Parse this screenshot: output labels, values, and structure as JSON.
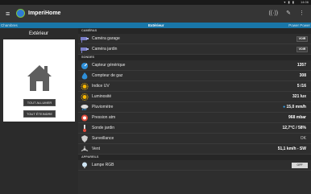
{
  "statusbar": {
    "icons": "▾ ▮ ▮",
    "clock": "14:06"
  },
  "appbar": {
    "title": "ImperiHome",
    "menu_icon": "menu-icon",
    "tools": [
      "((·))",
      "✎",
      "⋮"
    ]
  },
  "tabs": {
    "left": "Chambres",
    "center": "Extérieur",
    "right": "Power Power"
  },
  "room": {
    "title": "Extérieur",
    "button_all_on": "TOUT ALLUMER",
    "button_all_off": "TOUT ÉTEINDRE"
  },
  "sections": {
    "cameras": "CAMÉRAS",
    "sondes": "SONDES",
    "appareils": "APPAREILS"
  },
  "cameras": [
    {
      "label": "Caméra garage",
      "action": "VOIR"
    },
    {
      "label": "Caméra jardin",
      "action": "VOIR"
    }
  ],
  "sondes": [
    {
      "label": "Capteur générique",
      "value": "1357",
      "icon": "gauge-icon"
    },
    {
      "label": "Compteur de gaz",
      "value": "308",
      "icon": "flame-icon"
    },
    {
      "label": "Indice UV",
      "value": "5 /16",
      "icon": "sun-icon"
    },
    {
      "label": "Luminosité",
      "value": "321 lux",
      "icon": "sun-icon"
    },
    {
      "label": "Pluviomètre",
      "value": "15,0 mm/h",
      "icon": "rain-icon"
    },
    {
      "label": "Pression atm",
      "value": "968 mbar",
      "icon": "pressure-icon"
    },
    {
      "label": "Sonde jardin",
      "value": "12,7°C / 58%",
      "icon": "thermometer-icon"
    },
    {
      "label": "Surveillance",
      "value": "OK",
      "icon": "shield-icon"
    },
    {
      "label": "Vent",
      "value": "51,1 km/h - SW",
      "icon": "wind-icon"
    }
  ],
  "appareils": [
    {
      "label": "Lampe RGB",
      "action": "OFF",
      "icon": "bulb-icon"
    }
  ],
  "colors": {
    "accent": "#1976a8",
    "logo_ring": "#7dc242",
    "logo_fill": "#2e7bd6"
  }
}
